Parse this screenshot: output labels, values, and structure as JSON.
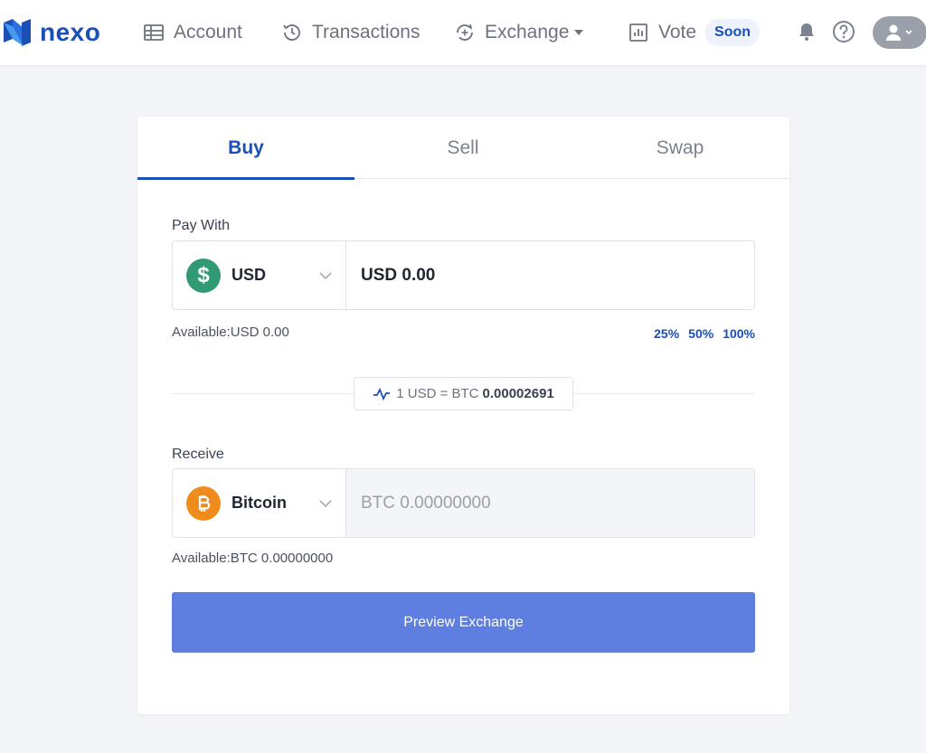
{
  "brand": {
    "name": "nexo",
    "color": "#1a4fb8"
  },
  "nav": {
    "account": "Account",
    "transactions": "Transactions",
    "exchange": "Exchange",
    "vote": "Vote",
    "vote_badge": "Soon"
  },
  "tabs": [
    {
      "label": "Buy",
      "active": true
    },
    {
      "label": "Sell",
      "active": false
    },
    {
      "label": "Swap",
      "active": false
    }
  ],
  "pay": {
    "label": "Pay With",
    "currency": "USD",
    "currency_symbol": "$",
    "amount": "USD 0.00",
    "available": "Available:USD 0.00",
    "percentages": [
      "25%",
      "50%",
      "100%"
    ]
  },
  "rate": {
    "prefix": "1 USD = BTC",
    "value": "0.00002691"
  },
  "receive": {
    "label": "Receive",
    "currency": "Bitcoin",
    "amount_placeholder": "BTC 0.00000000",
    "available": "Available:BTC 0.00000000"
  },
  "preview_button": "Preview Exchange",
  "colors": {
    "accent": "#1a4fb8",
    "button": "#5f7fe0",
    "usd": "#2f9a74",
    "btc": "#f08b1d"
  }
}
